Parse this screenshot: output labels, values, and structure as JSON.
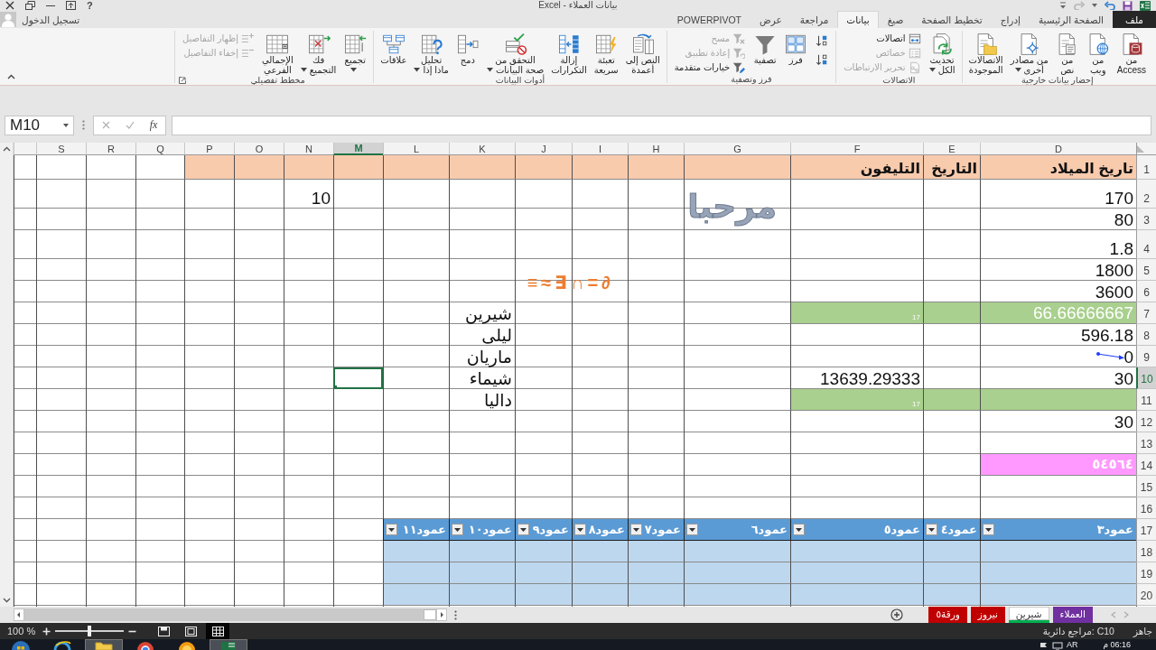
{
  "title_bar": {
    "title": "بيانات العملاء - Excel",
    "help": "?"
  },
  "quick_access": {
    "undo": {
      "disabled": false
    },
    "redo": {
      "disabled": true
    }
  },
  "tabs": [
    {
      "label": "ملف",
      "kind": "file",
      "selected": false
    },
    {
      "label": "الصفحة الرئيسية",
      "kind": "tab",
      "selected": false
    },
    {
      "label": "إدراج",
      "kind": "tab",
      "selected": false
    },
    {
      "label": "تخطيط الصفحة",
      "kind": "tab",
      "selected": false
    },
    {
      "label": "صيغ",
      "kind": "tab",
      "selected": false
    },
    {
      "label": "بيانات",
      "kind": "tab",
      "selected": true
    },
    {
      "label": "مراجعة",
      "kind": "tab",
      "selected": false
    },
    {
      "label": "عرض",
      "kind": "tab",
      "selected": false
    },
    {
      "label": "POWERPIVOT",
      "kind": "tab",
      "selected": false
    }
  ],
  "account": {
    "label": "تسجيل الدخول"
  },
  "ribbon": {
    "groups": [
      {
        "title": "إحضار بيانات خارجية",
        "launcher": false,
        "items": [
          {
            "kind": "large",
            "lines": [
              "من",
              "Access"
            ],
            "dropdown": false,
            "disabled": false
          },
          {
            "kind": "large",
            "lines": [
              "من",
              "ويب"
            ],
            "dropdown": false,
            "disabled": false
          },
          {
            "kind": "large",
            "lines": [
              "من",
              "نص"
            ],
            "dropdown": false,
            "disabled": false
          },
          {
            "kind": "large",
            "lines": [
              "من مصادر",
              "أخرى"
            ],
            "dropdown": true,
            "disabled": false
          },
          {
            "kind": "large",
            "lines": [
              "الاتصالات",
              "الموجودة"
            ],
            "dropdown": false,
            "disabled": false
          }
        ]
      },
      {
        "title": "الاتصالات",
        "launcher": false,
        "items": [
          {
            "kind": "large",
            "lines": [
              "تحديث",
              "الكل"
            ],
            "dropdown": true,
            "disabled": false
          },
          {
            "kind": "stack",
            "buttons": [
              {
                "label": "اتصالات",
                "disabled": false
              },
              {
                "label": "خصائص",
                "disabled": true
              },
              {
                "label": "تحرير الارتباطات",
                "disabled": true
              }
            ]
          }
        ]
      },
      {
        "title": "فرز وتصفية",
        "launcher": false,
        "items": [
          {
            "kind": "stack",
            "buttons": [
              {
                "disabled": false
              },
              {
                "disabled": false
              }
            ]
          },
          {
            "kind": "large",
            "lines": [
              "فرز"
            ],
            "dropdown": false,
            "disabled": false
          },
          {
            "kind": "large",
            "lines": [
              "تصفية"
            ],
            "dropdown": false,
            "disabled": false
          },
          {
            "kind": "stack",
            "buttons": [
              {
                "label": "مسح",
                "disabled": true
              },
              {
                "label": "إعادة تطبيق",
                "disabled": true
              },
              {
                "label": "خيارات متقدمة",
                "disabled": false
              }
            ]
          }
        ]
      },
      {
        "title": "أدوات البيانات",
        "launcher": false,
        "items": [
          {
            "kind": "large",
            "lines": [
              "النص إلى",
              "أعمدة"
            ],
            "dropdown": false,
            "disabled": false
          },
          {
            "kind": "large",
            "lines": [
              "تعبئة",
              "سريعة"
            ],
            "dropdown": false,
            "disabled": false
          },
          {
            "kind": "large",
            "lines": [
              "إزالة",
              "التكرارات"
            ],
            "dropdown": false,
            "disabled": false
          },
          {
            "kind": "large",
            "lines": [
              "التحقق من",
              "صحة البيانات"
            ],
            "dropdown": true,
            "disabled": false
          },
          {
            "kind": "large",
            "lines": [
              "دمج"
            ],
            "dropdown": false,
            "disabled": false
          },
          {
            "kind": "large",
            "lines": [
              "تحليل",
              "ماذا إذا"
            ],
            "dropdown": true,
            "disabled": false
          },
          {
            "kind": "large",
            "lines": [
              "علاقات"
            ],
            "dropdown": false,
            "disabled": false
          }
        ]
      },
      {
        "title": "مخطط تفصيلي",
        "launcher": true,
        "items": [
          {
            "kind": "large",
            "lines": [
              "تجميع"
            ],
            "dropdown": true,
            "disabled": false
          },
          {
            "kind": "large",
            "lines": [
              "فك",
              "التجميع"
            ],
            "dropdown": true,
            "disabled": false
          },
          {
            "kind": "large",
            "lines": [
              "الإجمالي",
              "الفرعي"
            ],
            "dropdown": false,
            "disabled": false
          },
          {
            "kind": "stack",
            "buttons": [
              {
                "label": "إظهار التفاصيل",
                "disabled": true
              },
              {
                "label": "إخفاء التفاصيل",
                "disabled": true
              }
            ]
          }
        ]
      }
    ]
  },
  "formula_bar": {
    "name_box": "M10",
    "function_label": "fx",
    "cancel": {
      "disabled": true
    },
    "enter": {
      "disabled": true
    }
  },
  "sheet": {
    "columns": [
      {
        "label": "D",
        "selected": false
      },
      {
        "label": "E",
        "selected": false
      },
      {
        "label": "F",
        "selected": false
      },
      {
        "label": "G",
        "selected": false
      },
      {
        "label": "H",
        "selected": false
      },
      {
        "label": "I",
        "selected": false
      },
      {
        "label": "J",
        "selected": false
      },
      {
        "label": "K",
        "selected": false
      },
      {
        "label": "L",
        "selected": false
      },
      {
        "label": "M",
        "selected": true
      },
      {
        "label": "N",
        "selected": false
      },
      {
        "label": "O",
        "selected": false
      },
      {
        "label": "P",
        "selected": false
      },
      {
        "label": "Q",
        "selected": false
      },
      {
        "label": "R",
        "selected": false
      },
      {
        "label": "S",
        "selected": false
      }
    ],
    "rows": [
      {
        "number": "1",
        "selected": false,
        "cells": [
          {
            "kind": "bold",
            "value": "تاريخ الميلاد",
            "color": "#f8cbad"
          },
          {
            "kind": "bold",
            "value": "التاريخ",
            "color": "#f8cbad"
          },
          {
            "kind": "bold",
            "value": "التليفون",
            "color": "#f8cbad"
          },
          {
            "kind": "fill",
            "color": "#f8cbad"
          },
          {
            "kind": "fill",
            "color": "#f8cbad"
          },
          {
            "kind": "fill",
            "color": "#f8cbad"
          },
          {
            "kind": "fill",
            "color": "#f8cbad"
          },
          {
            "kind": "fill",
            "color": "#f8cbad"
          },
          {
            "kind": "fill",
            "color": "#f8cbad"
          },
          {
            "kind": "fill",
            "color": "#f8cbad"
          },
          {
            "kind": "fill",
            "color": "#f8cbad"
          },
          {
            "kind": "fill",
            "color": "#f8cbad"
          },
          {
            "kind": "fill",
            "color": "#f8cbad"
          }
        ]
      },
      {
        "number": "2",
        "selected": false,
        "cells": [
          {
            "kind": "value",
            "value": "170"
          },
          null,
          null,
          null,
          null,
          null,
          null,
          null,
          null,
          null,
          {
            "kind": "value",
            "value": "10"
          }
        ]
      },
      {
        "number": "3",
        "selected": false,
        "cells": [
          {
            "kind": "value",
            "value": "80"
          }
        ]
      },
      {
        "number": "4",
        "selected": false,
        "cells": [
          {
            "kind": "value",
            "value": "1.8"
          }
        ]
      },
      {
        "number": "5",
        "selected": false,
        "cells": [
          {
            "kind": "value",
            "value": "1800"
          }
        ]
      },
      {
        "number": "6",
        "selected": false,
        "cells": [
          {
            "kind": "value",
            "value": "3600"
          }
        ]
      },
      {
        "number": "7",
        "selected": false,
        "cells": [
          {
            "kind": "light",
            "value": "66.66666667",
            "color": "#a9d08e"
          },
          {
            "kind": "fill",
            "color": "#a9d08e"
          },
          {
            "kind": "small",
            "value": "17",
            "color": "#a9d08e"
          },
          null,
          null,
          null,
          null,
          {
            "kind": "value",
            "value": "شيرين"
          }
        ]
      },
      {
        "number": "8",
        "selected": false,
        "cells": [
          {
            "kind": "value",
            "value": "596.18"
          },
          null,
          null,
          null,
          null,
          null,
          null,
          {
            "kind": "value",
            "value": "ليلى"
          }
        ]
      },
      {
        "number": "9",
        "selected": false,
        "cells": [
          {
            "kind": "value",
            "value": "0"
          },
          null,
          null,
          null,
          null,
          null,
          null,
          {
            "kind": "value",
            "value": "ماريان"
          }
        ]
      },
      {
        "number": "10",
        "selected": true,
        "cells": [
          {
            "kind": "value",
            "value": "30"
          },
          null,
          {
            "kind": "value",
            "value": "13639.29333"
          },
          null,
          null,
          null,
          null,
          {
            "kind": "value",
            "value": "شيماء"
          }
        ]
      },
      {
        "number": "11",
        "selected": false,
        "cells": [
          {
            "kind": "fill",
            "color": "#a9d08e"
          },
          {
            "kind": "fill",
            "color": "#a9d08e"
          },
          {
            "kind": "small",
            "value": "17",
            "color": "#a9d08e"
          },
          null,
          null,
          null,
          null,
          {
            "kind": "value",
            "value": "داليا"
          }
        ]
      },
      {
        "number": "12",
        "selected": false,
        "cells": [
          {
            "kind": "value",
            "value": "30"
          }
        ]
      },
      {
        "number": "13",
        "selected": false
      },
      {
        "number": "14",
        "selected": false,
        "cells": [
          {
            "kind": "caption",
            "value": "٥٤٥٦٤",
            "color": "#ff99ff"
          }
        ]
      },
      {
        "number": "15",
        "selected": false
      },
      {
        "number": "16",
        "selected": false
      },
      {
        "number": "17",
        "selected": false,
        "cells": [
          {
            "kind": "table_header",
            "value": "عمود٣",
            "color": "#5b9bd5"
          },
          {
            "kind": "table_header",
            "value": "عمود٤",
            "color": "#5b9bd5"
          },
          {
            "kind": "table_header",
            "value": "عمود٥",
            "color": "#5b9bd5"
          },
          {
            "kind": "table_header",
            "value": "عمود٦",
            "color": "#5b9bd5"
          },
          {
            "kind": "table_header",
            "value": "عمود٧",
            "color": "#5b9bd5"
          },
          {
            "kind": "table_header",
            "value": "عمود٨",
            "color": "#5b9bd5"
          },
          {
            "kind": "table_header",
            "value": "عمود٩",
            "color": "#5b9bd5"
          },
          {
            "kind": "table_header",
            "value": "عمود١٠",
            "color": "#5b9bd5"
          },
          {
            "kind": "table_header",
            "value": "عمود١١",
            "color": "#5b9bd5"
          }
        ]
      },
      {
        "number": "18",
        "selected": false,
        "cells": [
          {
            "kind": "fill",
            "color": "#bdd7ee"
          },
          {
            "kind": "fill",
            "color": "#bdd7ee"
          },
          {
            "kind": "fill",
            "color": "#bdd7ee"
          },
          {
            "kind": "fill",
            "color": "#bdd7ee"
          },
          {
            "kind": "fill",
            "color": "#bdd7ee"
          },
          {
            "kind": "fill",
            "color": "#bdd7ee"
          },
          {
            "kind": "fill",
            "color": "#bdd7ee"
          },
          {
            "kind": "fill",
            "color": "#bdd7ee"
          },
          {
            "kind": "fill",
            "color": "#bdd7ee"
          }
        ]
      },
      {
        "number": "19",
        "selected": false,
        "cells": [
          {
            "kind": "fill",
            "color": "#bdd7ee"
          },
          {
            "kind": "fill",
            "color": "#bdd7ee"
          },
          {
            "kind": "fill",
            "color": "#bdd7ee"
          },
          {
            "kind": "fill",
            "color": "#bdd7ee"
          },
          {
            "kind": "fill",
            "color": "#bdd7ee"
          },
          {
            "kind": "fill",
            "color": "#bdd7ee"
          },
          {
            "kind": "fill",
            "color": "#bdd7ee"
          },
          {
            "kind": "fill",
            "color": "#bdd7ee"
          },
          {
            "kind": "fill",
            "color": "#bdd7ee"
          }
        ]
      },
      {
        "number": "20",
        "selected": false,
        "cells": [
          {
            "kind": "fill",
            "color": "#bdd7ee"
          },
          {
            "kind": "fill",
            "color": "#bdd7ee"
          },
          {
            "kind": "fill",
            "color": "#bdd7ee"
          },
          {
            "kind": "fill",
            "color": "#bdd7ee"
          },
          {
            "kind": "fill",
            "color": "#bdd7ee"
          },
          {
            "kind": "fill",
            "color": "#bdd7ee"
          },
          {
            "kind": "fill",
            "color": "#bdd7ee"
          },
          {
            "kind": "fill",
            "color": "#bdd7ee"
          },
          {
            "kind": "fill",
            "color": "#bdd7ee"
          }
        ]
      }
    ],
    "shapes": [
      {
        "kind": "wordart",
        "text": "مرحبا"
      },
      {
        "kind": "equation",
        "text": "≡≈∃∩=∂"
      },
      {
        "kind": "tracer_arrow"
      }
    ]
  },
  "sheet_tabs": [
    {
      "label": "العملاء",
      "color": "#7030a0",
      "selected": false
    },
    {
      "label": "شيرين",
      "color": "#00b050",
      "selected": true
    },
    {
      "label": "نيروز",
      "color": "#c00000",
      "selected": false
    },
    {
      "label": "ورقة٥",
      "color": "#c00000",
      "selected": false
    }
  ],
  "status_bar": {
    "ready": "جاهز",
    "circular_references": "مراجع دائرية: C10",
    "zoom": "100 %",
    "zoom_slider": {
      "level": 0.5
    },
    "views": [
      {
        "selected": true
      },
      {
        "selected": false
      },
      {
        "selected": false
      }
    ]
  },
  "taskbar": {
    "apps": [
      {
        "open": false
      },
      {
        "open": false
      },
      {
        "open": true
      },
      {
        "open": false
      },
      {
        "open": false
      },
      {
        "open": true
      }
    ],
    "language": "AR",
    "clock": "06:16 م"
  }
}
